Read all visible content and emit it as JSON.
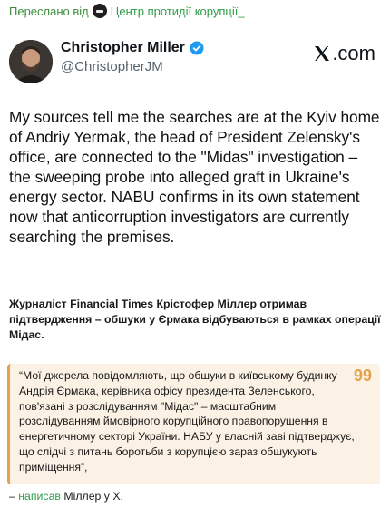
{
  "forward": {
    "label": "Переслано від",
    "channel": "Центр протидії корупції_"
  },
  "tweet": {
    "author_name": "Christopher Miller",
    "handle": "@ChristopherJM",
    "brand": ".com",
    "text": "My sources tell me the searches are at the Kyiv home of Andriy Yermak, the head of President Zelensky's office, are connected to the \"Midas\" investigation – the sweeping probe into alleged graft in Ukraine's energy sector. NABU confirms in its own statement now that anticorruption investigators are currently searching the premises."
  },
  "caption": "Журналіст Financial Times Крістофер Міллер отримав підтвердження – обшуки у Єрмака відбуваються в рамках операції Мідас.",
  "quote": {
    "text": "“Мої джерела повідомляють, що обшуки в київському будинку Андрія Єрмака, керівника офісу президента Зеленського, пов'язані з розслідуванням \"Мідас\" – масштабним розслідуванням ймовірного корупційного правопорушення в енергетичному секторі України. НАБУ у власній заві підтверджує, що слідчі з питань боротьби з корупцією зараз обшукують приміщення”,",
    "mark": "99"
  },
  "attribution": {
    "dash": "– ",
    "link": "написав",
    "rest": " Міллер у Х."
  },
  "colors": {
    "link_green": "#2e9e4a",
    "quote_bg": "#fbf1e4",
    "quote_accent": "#e3a14b",
    "verified_blue": "#1d9bf0"
  }
}
